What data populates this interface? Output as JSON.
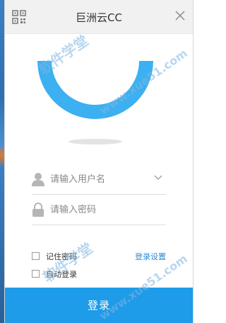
{
  "window": {
    "title": "巨洲云CC"
  },
  "login_form": {
    "username_placeholder": "请输入用户名",
    "password_placeholder": "请输入密码",
    "remember_password_label": "记住密码",
    "auto_login_label": "自动登录",
    "login_settings_link": "登录设置",
    "login_button": "登录"
  },
  "watermarks": {
    "brand": "软件学堂",
    "site": "www.xue51.com"
  },
  "colors": {
    "accent": "#1e9be9",
    "logo_blue": "#3cb0f0",
    "link": "#2a8ad6"
  },
  "icons": [
    "qr-code-icon",
    "close-icon",
    "user-icon",
    "lock-icon",
    "chevron-down-icon"
  ]
}
